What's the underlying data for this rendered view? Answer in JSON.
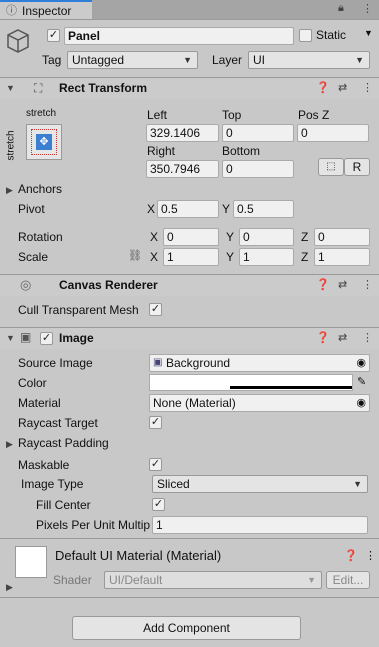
{
  "tab": {
    "label": "Inspector"
  },
  "object": {
    "name": "Panel",
    "static_label": "Static",
    "tag_label": "Tag",
    "tag_value": "Untagged",
    "layer_label": "Layer",
    "layer_value": "UI"
  },
  "rect_transform": {
    "title": "Rect Transform",
    "anchor_h": "stretch",
    "anchor_v": "stretch",
    "left_label": "Left",
    "top_label": "Top",
    "posz_label": "Pos Z",
    "left": "329.1406",
    "top": "0",
    "posz": "0",
    "right_label": "Right",
    "bottom_label": "Bottom",
    "right": "350.7946",
    "bottom": "0",
    "r_button": "R",
    "anchors_label": "Anchors",
    "pivot_label": "Pivot",
    "pivot_x": "0.5",
    "pivot_y": "0.5",
    "rotation_label": "Rotation",
    "rot_x": "0",
    "rot_y": "0",
    "rot_z": "0",
    "scale_label": "Scale",
    "scale_x": "1",
    "scale_y": "1",
    "scale_z": "1",
    "x": "X",
    "y": "Y",
    "z": "Z"
  },
  "canvas_renderer": {
    "title": "Canvas Renderer",
    "cull_label": "Cull Transparent Mesh"
  },
  "image": {
    "title": "Image",
    "source_label": "Source Image",
    "source_value": "Background",
    "color_label": "Color",
    "material_label": "Material",
    "material_value": "None (Material)",
    "raycast_target_label": "Raycast Target",
    "raycast_padding_label": "Raycast Padding",
    "maskable_label": "Maskable",
    "image_type_label": "Image Type",
    "image_type_value": "Sliced",
    "fill_center_label": "Fill Center",
    "ppu_label": "Pixels Per Unit Multip",
    "ppu_value": "1"
  },
  "material_preview": {
    "title": "Default UI Material (Material)",
    "shader_label": "Shader",
    "shader_value": "UI/Default",
    "edit_label": "Edit..."
  },
  "add_component": {
    "label": "Add Component"
  },
  "colors": {
    "accent": "#2f7fd8",
    "bg": "#c8c8c8",
    "field": "#f0f0f0"
  }
}
